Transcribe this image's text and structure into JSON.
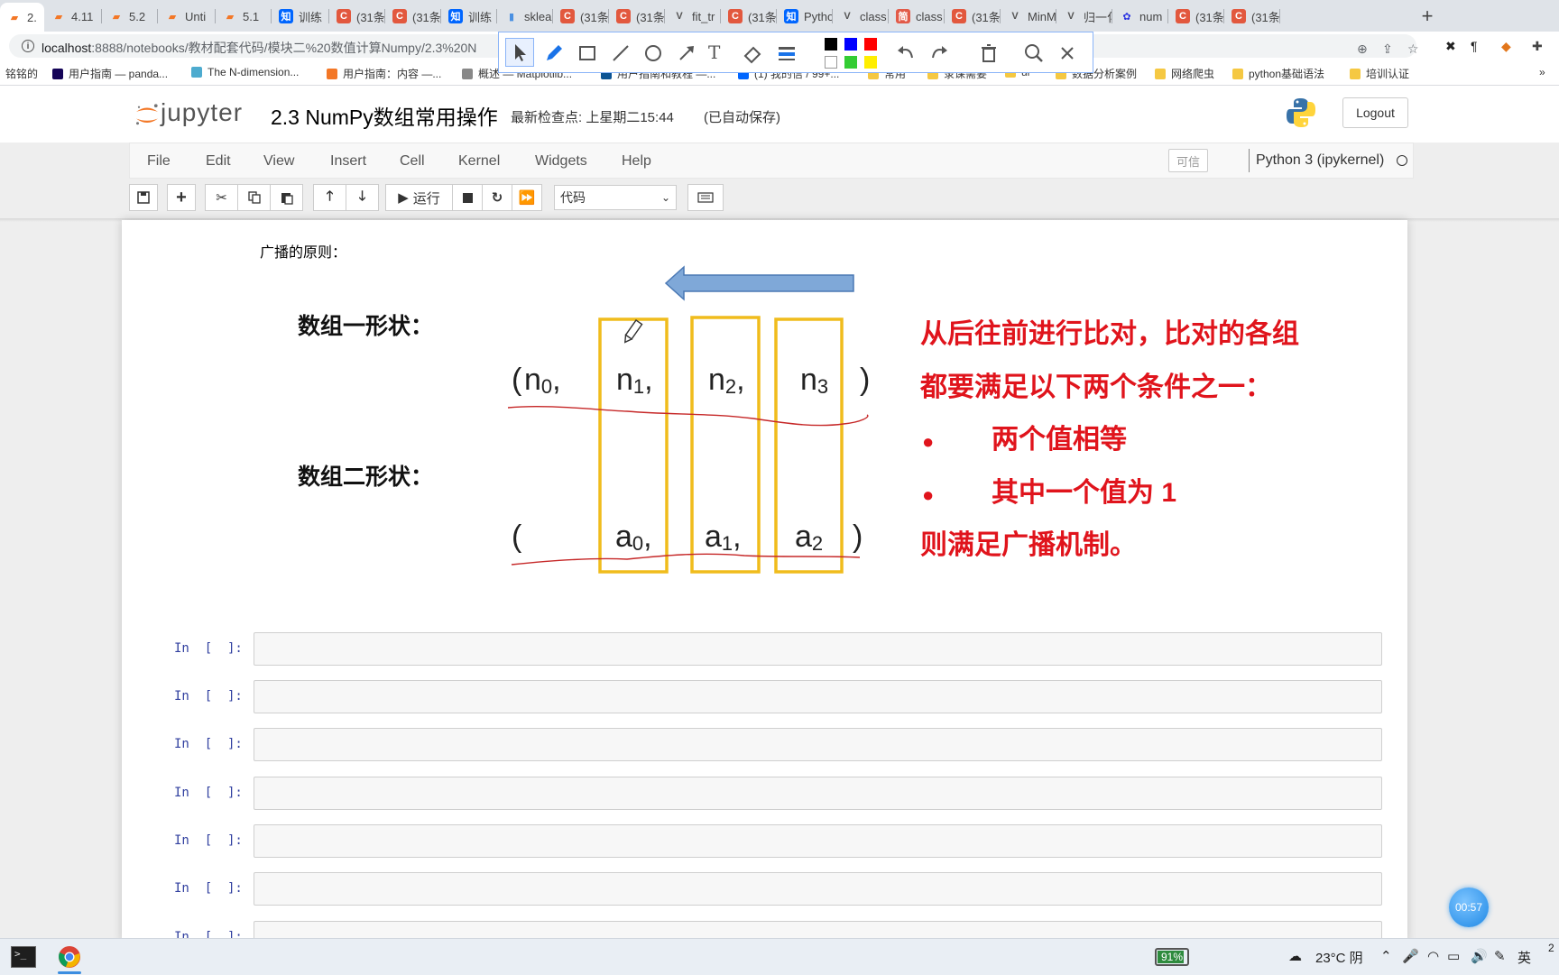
{
  "browser": {
    "tabs": [
      {
        "label": "2.",
        "fav": "jupyter",
        "color": "#f37726",
        "active": true,
        "close": "✕"
      },
      {
        "label": "4.11",
        "fav": "jupyter",
        "color": "#f37726"
      },
      {
        "label": "5.2",
        "fav": "jupyter",
        "color": "#f37726"
      },
      {
        "label": "Unti",
        "fav": "jupyter",
        "color": "#f37726"
      },
      {
        "label": "5.1",
        "fav": "jupyter",
        "color": "#f37726"
      },
      {
        "label": "训练",
        "fav": "知",
        "color": "#0066ff"
      },
      {
        "label": "(31条",
        "fav": "C",
        "color": "#e2583e"
      },
      {
        "label": "(31条",
        "fav": "C",
        "color": "#e2583e"
      },
      {
        "label": "训练",
        "fav": "知",
        "color": "#0066ff"
      },
      {
        "label": "sklea",
        "fav": "bars",
        "color": "#4a90e2"
      },
      {
        "label": "(31条",
        "fav": "C",
        "color": "#e2583e"
      },
      {
        "label": "(31条",
        "fav": "C",
        "color": "#e2583e"
      },
      {
        "label": "fit_tr",
        "fav": "V",
        "color": "#555555"
      },
      {
        "label": "(31条",
        "fav": "C",
        "color": "#e2583e"
      },
      {
        "label": "Pytho",
        "fav": "知",
        "color": "#0066ff"
      },
      {
        "label": "class",
        "fav": "V",
        "color": "#555555"
      },
      {
        "label": "class",
        "fav": "简",
        "color": "#e25a48"
      },
      {
        "label": "(31条",
        "fav": "C",
        "color": "#e2583e"
      },
      {
        "label": "MinM",
        "fav": "V",
        "color": "#555555"
      },
      {
        "label": "归一化",
        "fav": "V",
        "color": "#555555"
      },
      {
        "label": "num",
        "fav": "paw",
        "color": "#2932e1"
      },
      {
        "label": "(31条",
        "fav": "C",
        "color": "#e2583e"
      },
      {
        "label": "(31条",
        "fav": "C",
        "color": "#e2583e"
      }
    ],
    "new_tab": "+",
    "url_host": "localhost",
    "url_path": ":8888/notebooks/教材配套代码/模块二%20数值计算Numpy/2.3%20N",
    "bookmarks": [
      {
        "label": "铭铭的",
        "color": ""
      },
      {
        "label": "用户指南 — panda...",
        "color": "#150458"
      },
      {
        "label": "The N-dimension...",
        "color": "#4dabcf"
      },
      {
        "label": "用户指南：内容 —...",
        "color": "#f37726"
      },
      {
        "label": "概述 — Matplotlib...",
        "color": "#888888"
      },
      {
        "label": "用户指南和教程 —...",
        "color": "#0b5394"
      },
      {
        "label": "(1) 我的信 / 99+...",
        "color": "#0066ff"
      },
      {
        "label": "常用",
        "color": "#f5c842"
      },
      {
        "label": "录课需要",
        "color": "#f5c842"
      },
      {
        "label": "ui",
        "color": "#f5c842"
      },
      {
        "label": "数据分析案例",
        "color": "#f5c842"
      },
      {
        "label": "网络爬虫",
        "color": "#f5c842"
      },
      {
        "label": "python基础语法",
        "color": "#f5c842"
      },
      {
        "label": "培训认证",
        "color": "#f5c842"
      }
    ],
    "bookmarks_more": "»"
  },
  "annotation_toolbar": {
    "colors": [
      "#000000",
      "#0000ff",
      "#ff0000",
      "#ffffff",
      "#33cc33",
      "#ffee00"
    ]
  },
  "jupyter": {
    "logo_text": "jupyter",
    "notebook_title": "2.3 NumPy数组常用操作",
    "checkpoint": "最新检查点: 上星期二15:44",
    "autosave": "(已自动保存)",
    "logout": "Logout",
    "menu": [
      "File",
      "Edit",
      "View",
      "Insert",
      "Cell",
      "Kernel",
      "Widgets",
      "Help"
    ],
    "trusted": "可信",
    "kernel": "Python 3 (ipykernel)",
    "run_label": "运行",
    "cell_type": "代码"
  },
  "notebook": {
    "markdown_text": "广播的原则：",
    "diagram": {
      "label1": "数组一形状：",
      "label2": "数组二形状：",
      "shape1": {
        "open": "(",
        "items": [
          [
            "n",
            "0",
            ","
          ],
          [
            "n",
            "1",
            ","
          ],
          [
            "n",
            "2",
            ","
          ],
          [
            "n",
            "3",
            ""
          ]
        ],
        "close": ")"
      },
      "shape2": {
        "open": "(",
        "items": [
          [
            "a",
            "0",
            ","
          ],
          [
            "a",
            "1",
            ","
          ],
          [
            "a",
            "2",
            ""
          ]
        ],
        "close": ")"
      },
      "rule_lines": [
        "从后往前进行比对，比对的各组",
        "都要满足以下两个条件之一：",
        "两个值相等",
        "其中一个值为 1",
        "则满足广播机制。"
      ],
      "bullet": "●",
      "colors": {
        "text_red": "#e0141c",
        "box": "#f0bc1c",
        "arrow": "#7fa8d8",
        "arrow_stroke": "#4a78b4",
        "wavy": "#c62828"
      }
    },
    "cells": [
      {
        "prompt": "In  [  ]:"
      },
      {
        "prompt": "In  [  ]:"
      },
      {
        "prompt": "In  [  ]:"
      },
      {
        "prompt": "In  [  ]:"
      },
      {
        "prompt": "In  [  ]:"
      },
      {
        "prompt": "In  [  ]:"
      },
      {
        "prompt": "In  [  ]:"
      }
    ]
  },
  "timer": "00:57",
  "taskbar": {
    "battery": "91%",
    "battery_level": 0.91,
    "weather": "23°C  阴",
    "ime": "英",
    "clock": "2"
  }
}
